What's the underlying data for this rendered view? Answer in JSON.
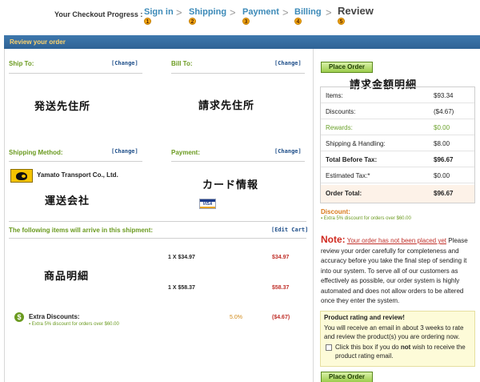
{
  "progress": {
    "label": "Your Checkout Progress :",
    "steps": [
      {
        "name": "Sign in",
        "number": "1"
      },
      {
        "name": "Shipping",
        "number": "2"
      },
      {
        "name": "Payment",
        "number": "3"
      },
      {
        "name": "Billing",
        "number": "4"
      },
      {
        "name": "Review",
        "number": "5"
      }
    ],
    "separator": ">",
    "current_step": "Review"
  },
  "header": {
    "title": "Review your order"
  },
  "ship_to": {
    "title": "Ship To:",
    "change": "[Change]",
    "content": "発送先住所"
  },
  "bill_to": {
    "title": "Bill To:",
    "change": "[Change]",
    "content": "請求先住所"
  },
  "shipping_method": {
    "title": "Shipping Method:",
    "change": "[Change]",
    "carrier": "Yamato Transport Co., Ltd.",
    "content": "運送会社",
    "logo_icon": "yamato-cat-logo"
  },
  "payment": {
    "title": "Payment:",
    "change": "[Change]",
    "content": "カード情報",
    "card_icon": "visa-card",
    "card_text": "VISA"
  },
  "items": {
    "title": "The following items will arrive in this shipment:",
    "edit": "[Edit Cart]",
    "content": "商品明細",
    "rows": [
      {
        "qty_price": "1 X $34.97",
        "total": "$34.97"
      },
      {
        "qty_price": "1 X $58.37",
        "total": "$58.37"
      }
    ],
    "extra": {
      "label": "Extra Discounts:",
      "note": "Extra 5% discount for orders over $60.00",
      "percent": "5.0%",
      "amount": "($4.67)",
      "icon": "dollar-icon"
    }
  },
  "summary": {
    "place_order": "Place Order",
    "heading": "請求金額明細",
    "rows": [
      {
        "label": "Items:",
        "value": "$93.34",
        "style": "normal"
      },
      {
        "label": "Discounts:",
        "value": "($4.67)",
        "style": "normal"
      },
      {
        "label": "Rewards:",
        "value": "$0.00",
        "style": "green"
      },
      {
        "label": "Shipping & Handling:",
        "value": "$8.00",
        "style": "normal"
      },
      {
        "label": "Total Before Tax:",
        "value": "$96.67",
        "style": "bold"
      },
      {
        "label": "Estimated Tax:*",
        "value": "$0.00",
        "style": "normal"
      },
      {
        "label": "Order Total:",
        "value": "$96.67",
        "style": "total"
      }
    ],
    "discount_label": "Discount:",
    "discount_note": "Extra 5% discount for orders over $60.00",
    "note_label": "Note:",
    "note_link": "Your order has not been placed yet",
    "note_text": "Please review your order carefully for completeness and accuracy before you take the final step of sending it into our system. To serve all of our customers as effectively as possible, our order system is highly automated and does not allow orders to be altered once they enter the system.",
    "rating_title": "Product rating and review!",
    "rating_text": "You will receive an email in about 3 weeks to rate and review the product(s) you are ordering now.",
    "checkbox_pre": "Click this box if you do",
    "checkbox_bold": "not",
    "checkbox_post": "wish to receive the product rating email.",
    "place_order_bottom": "Place Order"
  },
  "colors": {
    "accent_blue": "#3c8ab8",
    "section_green": "#6a9a1f",
    "price_red": "#c0302a",
    "header_bar": "#2f6395"
  }
}
